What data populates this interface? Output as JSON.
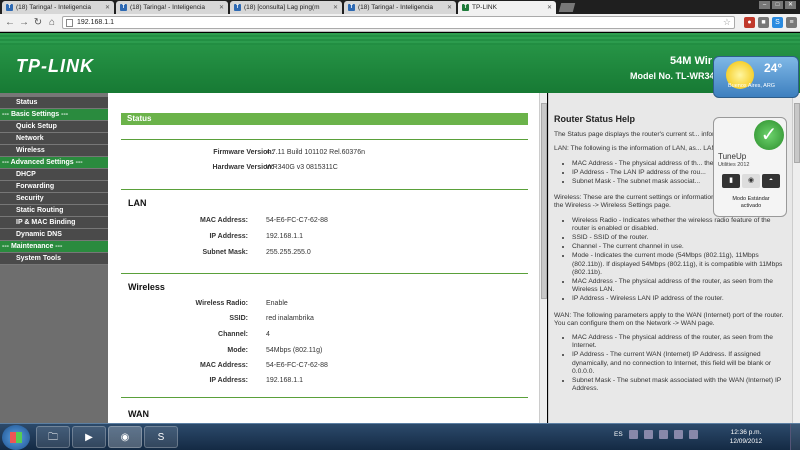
{
  "browser": {
    "tabs": [
      {
        "label": "(18) Taringa! - Inteligencia",
        "icon": "taringa"
      },
      {
        "label": "(18) Taringa! - Inteligencia",
        "icon": "taringa"
      },
      {
        "label": "(18) [consulta] Lag ping(m",
        "icon": "taringa"
      },
      {
        "label": "(18) Taringa! - Inteligencia",
        "icon": "taringa"
      },
      {
        "label": "TP-LINK",
        "icon": "tplink",
        "active": true
      }
    ],
    "url": "192.168.1.1"
  },
  "router": {
    "logo": "TP-LINK",
    "product_name": "54M Wir",
    "model": "Model No. TL-WR34",
    "menu": [
      {
        "label": "Status",
        "type": "item"
      },
      {
        "label": "--- Basic Settings ---",
        "type": "header"
      },
      {
        "label": "Quick Setup",
        "type": "item"
      },
      {
        "label": "Network",
        "type": "item"
      },
      {
        "label": "Wireless",
        "type": "item"
      },
      {
        "label": "--- Advanced Settings ---",
        "type": "header"
      },
      {
        "label": "DHCP",
        "type": "item"
      },
      {
        "label": "Forwarding",
        "type": "item"
      },
      {
        "label": "Security",
        "type": "item"
      },
      {
        "label": "Static Routing",
        "type": "item"
      },
      {
        "label": "IP & MAC Binding",
        "type": "item"
      },
      {
        "label": "Dynamic DNS",
        "type": "item"
      },
      {
        "label": "--- Maintenance ---",
        "type": "header"
      },
      {
        "label": "System Tools",
        "type": "item"
      }
    ],
    "status": {
      "title": "Status",
      "firmware_label": "Firmware Version:",
      "firmware_value": "4.7.11 Build 101102 Rel.60376n",
      "hardware_label": "Hardware Version:",
      "hardware_value": "WR340G v3 0815311C"
    },
    "lan": {
      "title": "LAN",
      "mac_label": "MAC Address:",
      "mac_value": "54-E6-FC-C7-62-88",
      "ip_label": "IP Address:",
      "ip_value": "192.168.1.1",
      "mask_label": "Subnet Mask:",
      "mask_value": "255.255.255.0"
    },
    "wireless": {
      "title": "Wireless",
      "radio_label": "Wireless Radio:",
      "radio_value": "Enable",
      "ssid_label": "SSID:",
      "ssid_value": "red inalambrika",
      "channel_label": "Channel:",
      "channel_value": "4",
      "mode_label": "Mode:",
      "mode_value": "54Mbps (802.11g)",
      "mac_label": "MAC Address:",
      "mac_value": "54-E6-FC-C7-62-88",
      "ip_label": "IP Address:",
      "ip_value": "192.168.1.1"
    },
    "wan": {
      "title": "WAN"
    },
    "help": {
      "title": "Router Status Help",
      "intro": "The Status page displays the router's current st... information is read-only.",
      "lan_intro": "LAN: The following is the information of LAN, as... LAN page.",
      "lan_items": [
        "MAC Address - The physical address of th... the LAN.",
        "IP Address - The LAN IP address of the rou...",
        "Subnet Mask - The subnet mask associat..."
      ],
      "wireless_intro": "Wireless: These are the current settings or information for Wireless, as set on the Wireless -> Wireless Settings page.",
      "wireless_items": [
        "Wireless Radio - Indicates whether the wireless radio feature of the router is enabled or disabled.",
        "SSID - SSID of the router.",
        "Channel - The current channel in use.",
        "Mode - Indicates the current mode (54Mbps (802.11g), 11Mbps (802.11b)). If displayed 54Mbps (802.11g), it is compatible with 11Mbps (802.11b).",
        "MAC Address - The physical address of the router, as seen from the Wireless LAN.",
        "IP Address - Wireless LAN IP address of the router."
      ],
      "wan_intro": "WAN: The following parameters apply to the WAN (Internet) port of the router. You can configure them on the Network -> WAN page.",
      "wan_items": [
        "MAC Address - The physical address of the router, as seen from the Internet.",
        "IP Address - The current WAN (Internet) IP Address. If assigned dynamically, and no connection to Internet, this field will be blank or 0.0.0.0.",
        "Subnet Mask - The subnet mask associated with the WAN (Internet) IP Address."
      ]
    }
  },
  "gadgets": {
    "weather": {
      "temp": "24°",
      "city": "Buenos Aires, ARG"
    },
    "tuneup": {
      "name": "TuneUp",
      "sub": "Utilities 2012",
      "mode_line1": "Modo Estándar",
      "mode_line2": "activado"
    }
  },
  "taskbar": {
    "lang": "ES",
    "time": "12:36 p.m.",
    "date": "12/09/2012"
  }
}
